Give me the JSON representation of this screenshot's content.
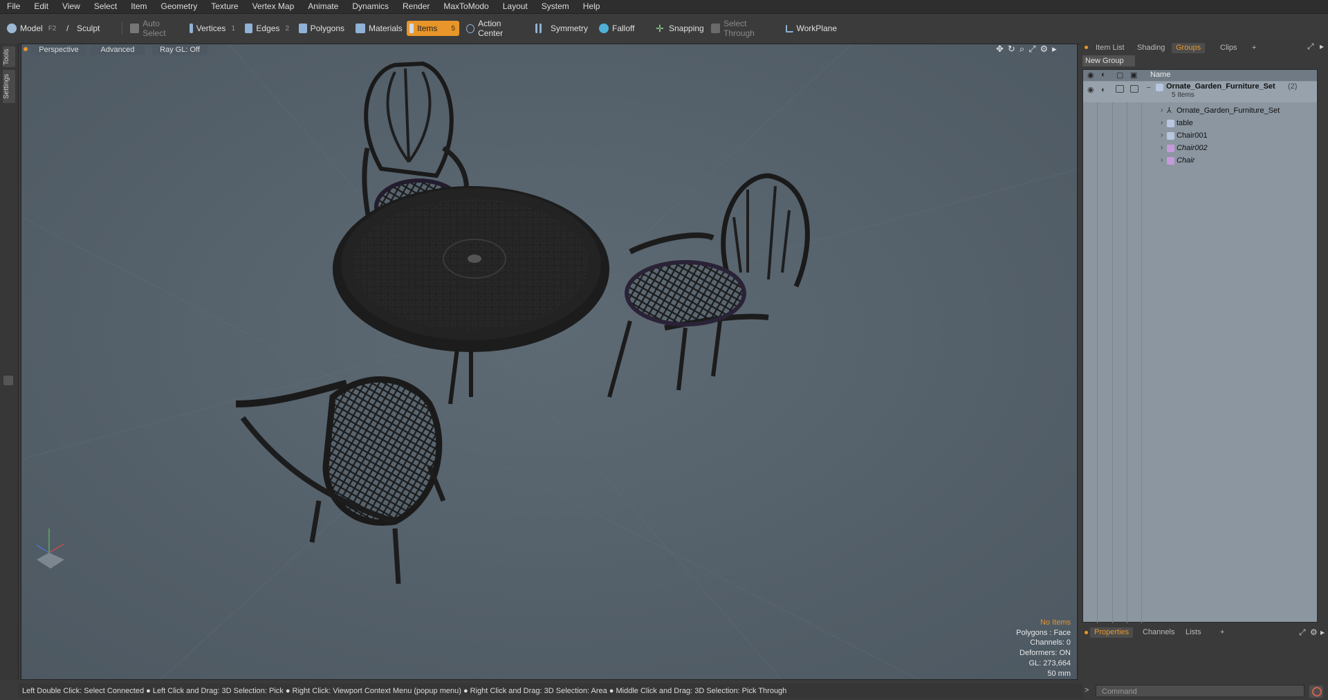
{
  "menu": [
    "File",
    "Edit",
    "View",
    "Select",
    "Item",
    "Geometry",
    "Texture",
    "Vertex Map",
    "Animate",
    "Dynamics",
    "Render",
    "MaxToModo",
    "Layout",
    "System",
    "Help"
  ],
  "toolbar": {
    "model": "Model",
    "model_key": "F2",
    "sculpt": "Sculpt",
    "auto_select": "Auto Select",
    "vertices": "Vertices",
    "vertices_num": "1",
    "edges": "Edges",
    "edges_num": "2",
    "polygons": "Polygons",
    "materials": "Materials",
    "items": "Items",
    "items_num": "5",
    "action_center": "Action Center",
    "symmetry": "Symmetry",
    "falloff": "Falloff",
    "snapping": "Snapping",
    "select_through": "Select Through",
    "workplane": "WorkPlane"
  },
  "left_tabs": {
    "tools": "Tools",
    "settings": "Settings"
  },
  "viewport": {
    "view": "Perspective",
    "shading": "Advanced",
    "raygl": "Ray GL: Off"
  },
  "info": {
    "items": "No Items",
    "polygons": "Polygons : Face",
    "channels": "Channels: 0",
    "deformers": "Deformers: ON",
    "gl": "GL: 273,664",
    "lens": "50 mm"
  },
  "status": "Left Double Click: Select Connected ● Left Click and Drag: 3D Selection: Pick ● Right Click: Viewport Context Menu (popup menu) ● Right Click and Drag: 3D Selection: Area ● Middle Click and Drag: 3D Selection: Pick Through",
  "right_tabs": [
    "Item List",
    "Shading",
    "Groups",
    "Clips",
    "+"
  ],
  "new_group": "New Group",
  "groups": {
    "header": "Name",
    "root": "Ornate_Garden_Furniture_Set",
    "root_count": "(2)",
    "root_sub": "5 Items",
    "children": [
      "Ornate_Garden_Furniture_Set",
      "table",
      "Chair001",
      "Chair002",
      "Chair"
    ]
  },
  "bottom_tabs": [
    "Properties",
    "Channels",
    "Lists",
    "+"
  ],
  "command_placeholder": "Command",
  "colors": {
    "accent": "#e8962a",
    "viewport_bg": "#56626c",
    "list_bg": "#8b96a0"
  }
}
